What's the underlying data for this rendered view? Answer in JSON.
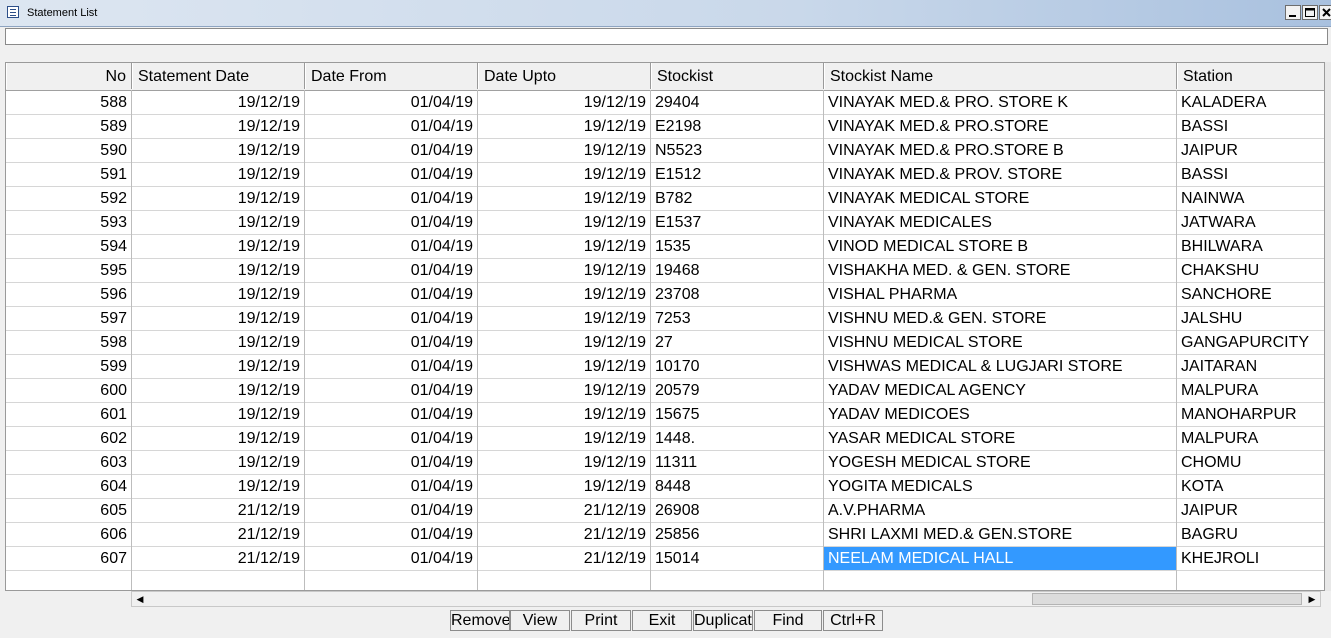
{
  "window": {
    "title": "Statement List"
  },
  "table": {
    "columns": [
      "No",
      "Statement Date",
      "Date From",
      "Date Upto",
      "Stockist",
      "Stockist Name",
      "Station"
    ],
    "rows": [
      [
        "588",
        "19/12/19",
        "01/04/19",
        "19/12/19",
        "29404",
        "VINAYAK MED.& PRO. STORE K",
        "KALADERA"
      ],
      [
        "589",
        "19/12/19",
        "01/04/19",
        "19/12/19",
        "E2198",
        "VINAYAK MED.& PRO.STORE",
        "BASSI"
      ],
      [
        "590",
        "19/12/19",
        "01/04/19",
        "19/12/19",
        "N5523",
        "VINAYAK MED.& PRO.STORE B",
        "JAIPUR"
      ],
      [
        "591",
        "19/12/19",
        "01/04/19",
        "19/12/19",
        "E1512",
        "VINAYAK MED.& PROV. STORE",
        "BASSI"
      ],
      [
        "592",
        "19/12/19",
        "01/04/19",
        "19/12/19",
        "B782",
        "VINAYAK MEDICAL STORE",
        "NAINWA"
      ],
      [
        "593",
        "19/12/19",
        "01/04/19",
        "19/12/19",
        "E1537",
        "VINAYAK MEDICALES",
        "JATWARA"
      ],
      [
        "594",
        "19/12/19",
        "01/04/19",
        "19/12/19",
        "1535",
        "VINOD MEDICAL STORE B",
        "BHILWARA"
      ],
      [
        "595",
        "19/12/19",
        "01/04/19",
        "19/12/19",
        "19468",
        "VISHAKHA MED. & GEN. STORE",
        "CHAKSHU"
      ],
      [
        "596",
        "19/12/19",
        "01/04/19",
        "19/12/19",
        "23708",
        "VISHAL PHARMA",
        "SANCHORE"
      ],
      [
        "597",
        "19/12/19",
        "01/04/19",
        "19/12/19",
        "7253",
        "VISHNU MED.& GEN. STORE",
        "JALSHU"
      ],
      [
        "598",
        "19/12/19",
        "01/04/19",
        "19/12/19",
        "27",
        "VISHNU MEDICAL STORE",
        "GANGAPURCITY"
      ],
      [
        "599",
        "19/12/19",
        "01/04/19",
        "19/12/19",
        "10170",
        "VISHWAS MEDICAL & LUGJARI STORE",
        "JAITARAN"
      ],
      [
        "600",
        "19/12/19",
        "01/04/19",
        "19/12/19",
        "20579",
        "YADAV MEDICAL AGENCY",
        "MALPURA"
      ],
      [
        "601",
        "19/12/19",
        "01/04/19",
        "19/12/19",
        "15675",
        "YADAV MEDICOES",
        "MANOHARPUR"
      ],
      [
        "602",
        "19/12/19",
        "01/04/19",
        "19/12/19",
        "1448.",
        "YASAR MEDICAL STORE",
        "MALPURA"
      ],
      [
        "603",
        "19/12/19",
        "01/04/19",
        "19/12/19",
        "11311",
        "YOGESH MEDICAL STORE",
        "CHOMU"
      ],
      [
        "604",
        "19/12/19",
        "01/04/19",
        "19/12/19",
        "8448",
        "YOGITA MEDICALS",
        "KOTA"
      ],
      [
        "605",
        "21/12/19",
        "01/04/19",
        "21/12/19",
        "26908",
        "A.V.PHARMA",
        "JAIPUR"
      ],
      [
        "606",
        "21/12/19",
        "01/04/19",
        "21/12/19",
        "25856",
        "SHRI LAXMI MED.& GEN.STORE",
        "BAGRU"
      ],
      [
        "607",
        "21/12/19",
        "01/04/19",
        "21/12/19",
        "15014",
        "NEELAM MEDICAL HALL",
        "KHEJROLI"
      ]
    ],
    "selected_row": 19,
    "selected_col": 5
  },
  "buttons": [
    "Remove",
    "View",
    "Print",
    "Exit",
    "Duplicate",
    "Find",
    "Ctrl+R"
  ],
  "colors": {
    "selection": "#3399ff",
    "title_gradient_end": "#a9c1df"
  }
}
